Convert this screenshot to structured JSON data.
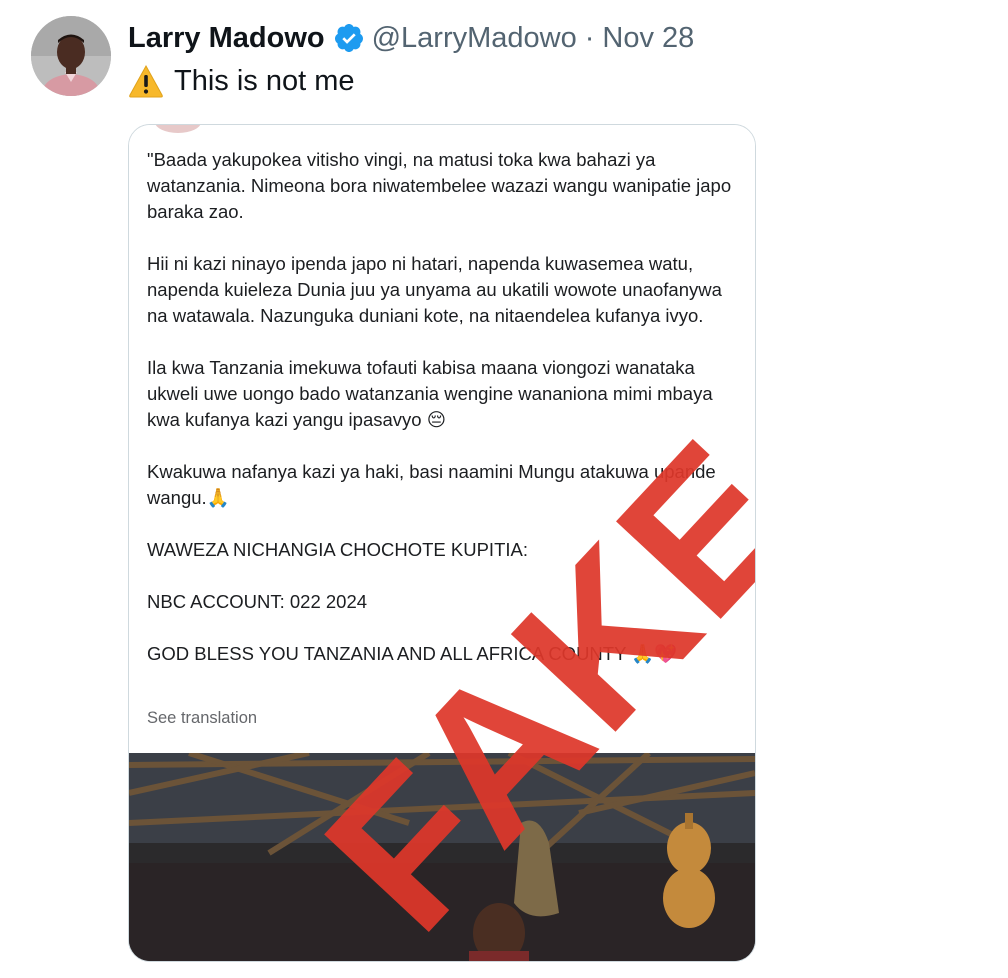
{
  "author": {
    "display_name": "Larry Madowo",
    "handle": "@LarryMadowo",
    "separator": "·",
    "date": "Nov 28"
  },
  "tweet": {
    "text": "This is not me",
    "prefix_icon": "warning-icon"
  },
  "quoted_post": {
    "paragraphs": [
      "\"Baada yakupokea vitisho vingi, na matusi toka kwa bahazi ya watanzania. Nimeona bora niwatembelee wazazi wangu wanipatie japo baraka zao.",
      "Hii ni kazi ninayo ipenda japo ni hatari, napenda kuwasemea watu, napenda kuieleza Dunia juu ya unyama au ukatili wowote unaofanywa na watawala. Nazunguka duniani kote, na nitaendelea kufanya ivyo.",
      "Ila kwa Tanzania imekuwa tofauti kabisa maana viongozi wanataka ukweli uwe uongo bado watanzania wengine wananiona mimi mbaya kwa kufanya kazi yangu ipasavyo 😔",
      "Kwakuwa nafanya kazi ya haki, basi naamini Mungu atakuwa upande wangu.🙏",
      "WAWEZA NICHANGIA CHOCHOTE KUPITIA:",
      "NBC ACCOUNT:  022 2024",
      "GOD BLESS YOU TANZANIA AND ALL AFRICA COUNTY 🙏💖"
    ],
    "see_translation": "See translation"
  },
  "overlay": {
    "stamp_text": "FAKE"
  },
  "colors": {
    "verified_blue": "#1d9bf0",
    "stamp_red": "#de372a",
    "muted_text": "#536471"
  }
}
